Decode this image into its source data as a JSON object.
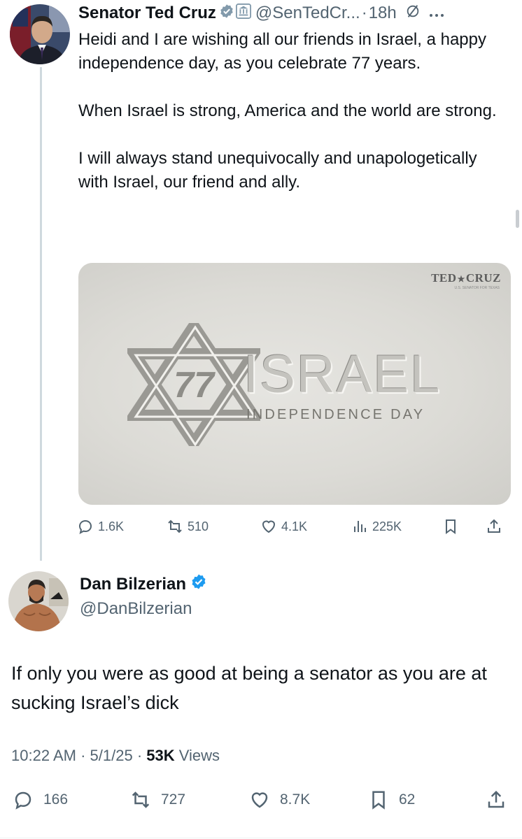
{
  "tweet1": {
    "author_name": "Senator Ted Cruz",
    "handle": "@SenTedCr...",
    "separator": "·",
    "time": "18h",
    "paragraphs": [
      "Heidi and I are wishing all our friends in Israel, a happy independence day, as you celebrate 77 years.",
      "When Israel is strong, America and the world are strong.",
      "I will always stand unequivocally and unapologetically with Israel, our friend and ally."
    ],
    "media": {
      "brand_left": "TED",
      "brand_right": "CRUZ",
      "brand_sub": "U.S. SENATOR FOR TEXAS",
      "star_number": "77",
      "title": "ISRAEL",
      "subtitle": "INDEPENDENCE DAY"
    },
    "stats": {
      "replies": "1.6K",
      "reposts": "510",
      "likes": "4.1K",
      "views": "225K"
    }
  },
  "tweet2": {
    "author_name": "Dan Bilzerian",
    "handle": "@DanBilzerian",
    "body": "If only you were as good at being a senator as you are at sucking Israel’s dick",
    "time": "10:22 AM",
    "separator": "·",
    "date": "5/1/25",
    "views_count": "53K",
    "views_label": "Views",
    "stats": {
      "replies": "166",
      "reposts": "727",
      "likes": "8.7K",
      "bookmarks": "62"
    }
  },
  "icons": [
    "verified-badge-icon",
    "government-badge-icon",
    "mute-icon",
    "more-icon",
    "reply-icon",
    "repost-icon",
    "like-icon",
    "views-icon",
    "bookmark-icon",
    "share-icon"
  ],
  "colors": {
    "verified_blue": "#1d9bf0",
    "muted_text": "#536471",
    "text": "#0f1419"
  }
}
